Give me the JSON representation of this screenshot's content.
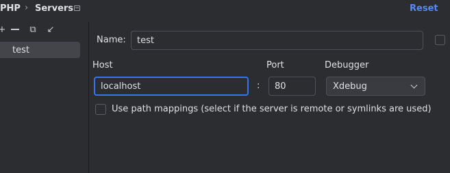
{
  "breadcrumb": {
    "root": "PHP",
    "separator": "›",
    "current": "Servers"
  },
  "header": {
    "reset_label": "Reset"
  },
  "toolbar": {
    "add_symbol": "+",
    "copy_symbol": "⧉",
    "import_symbol": "↙"
  },
  "servers_list": {
    "items": [
      {
        "label": "test"
      }
    ]
  },
  "form": {
    "name_label": "Name:",
    "name_value": "test",
    "host_label": "Host",
    "host_value": "localhost",
    "colon": ":",
    "port_label": "Port",
    "port_value": "80",
    "debugger_label": "Debugger",
    "debugger_value": "Xdebug",
    "path_mappings_label": "Use path mappings (select if the server is remote or symlinks are used)",
    "path_mappings_checked": false
  },
  "colors": {
    "background": "#2b2d30",
    "accent": "#3574f0",
    "link": "#548af7"
  }
}
